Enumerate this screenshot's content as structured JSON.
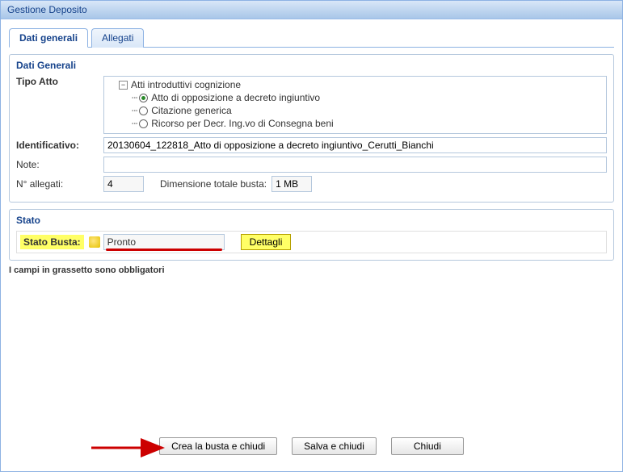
{
  "window": {
    "title": "Gestione Deposito"
  },
  "tabs": [
    {
      "label": "Dati generali",
      "active": true
    },
    {
      "label": "Allegati",
      "active": false
    }
  ],
  "dati_generali": {
    "title": "Dati Generali",
    "tipo_atto": {
      "label": "Tipo Atto",
      "root": "Atti introduttivi cognizione",
      "options": [
        {
          "label": "Atto di opposizione a decreto ingiuntivo",
          "selected": true
        },
        {
          "label": "Citazione generica",
          "selected": false
        },
        {
          "label": "Ricorso per Decr. Ing.vo di Consegna beni",
          "selected": false
        }
      ]
    },
    "identificativo": {
      "label": "Identificativo:",
      "value": "20130604_122818_Atto di opposizione a decreto ingiuntivo_Cerutti_Bianchi"
    },
    "note": {
      "label": "Note:",
      "value": ""
    },
    "n_allegati": {
      "label": "N° allegati:",
      "value": "4"
    },
    "dimensione": {
      "label": "Dimensione totale busta:",
      "value": "1 MB"
    }
  },
  "stato": {
    "title": "Stato",
    "row": {
      "label": "Stato Busta:",
      "value": "Pronto",
      "button": "Dettagli"
    }
  },
  "required_note": "I campi in grassetto sono obbligatori",
  "buttons": {
    "create": "Crea la busta e chiudi",
    "save": "Salva e chiudi",
    "close": "Chiudi"
  }
}
